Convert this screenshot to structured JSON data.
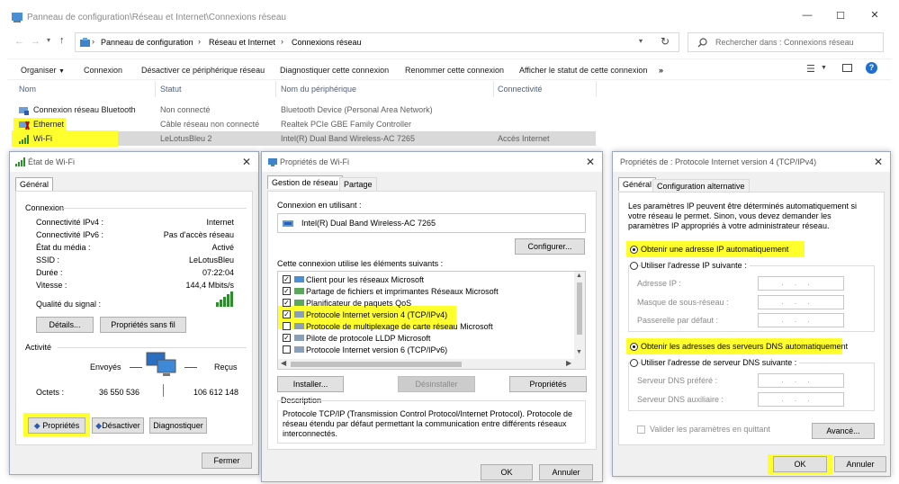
{
  "explorer": {
    "title": "Panneau de configuration\\Réseau et Internet\\Connexions réseau",
    "breadcrumb": [
      "Panneau de configuration",
      "Réseau et Internet",
      "Connexions réseau"
    ],
    "search_placeholder": "Rechercher dans : Connexions réseau",
    "commands": [
      "Organiser",
      "Connexion",
      "Désactiver ce périphérique réseau",
      "Diagnostiquer cette connexion",
      "Renommer cette connexion",
      "Afficher le statut de cette connexion",
      "»"
    ],
    "columns": [
      "Nom",
      "Statut",
      "Nom du périphérique",
      "Connectivité"
    ],
    "rows": [
      {
        "name": "Connexion réseau Bluetooth",
        "status": "Non connecté",
        "device": "Bluetooth Device (Personal Area Network)",
        "connectivity": ""
      },
      {
        "name": "Ethernet",
        "status": "Câble réseau non connecté",
        "device": "Realtek PCIe GBE Family Controller",
        "connectivity": ""
      },
      {
        "name": "Wi-Fi",
        "status": "LeLotusBleu  2",
        "device": "Intel(R) Dual Band Wireless-AC 7265",
        "connectivity": "Accès Internet"
      }
    ]
  },
  "status_dialog": {
    "title": "État de Wi-Fi",
    "tab": "Général",
    "connection_group": "Connexion",
    "fields": [
      {
        "label": "Connectivité IPv4 :",
        "value": "Internet"
      },
      {
        "label": "Connectivité IPv6 :",
        "value": "Pas d'accès réseau"
      },
      {
        "label": "État du média :",
        "value": "Activé"
      },
      {
        "label": "SSID :",
        "value": "LeLotusBleu"
      },
      {
        "label": "Durée :",
        "value": "07:22:04"
      },
      {
        "label": "Vitesse :",
        "value": "144,4 Mbits/s"
      }
    ],
    "signal_label": "Qualité du signal :",
    "details_button": "Détails...",
    "wireless_props_button": "Propriétés sans fil",
    "activity_group": "Activité",
    "sent_label": "Envoyés",
    "received_label": "Reçus",
    "octets_label": "Octets :",
    "octets_sent": "36 550 536",
    "octets_received": "106 612 148",
    "properties_button": "Propriétés",
    "disable_button": "Désactiver",
    "diagnose_button": "Diagnostiquer",
    "close_button": "Fermer"
  },
  "props_dialog": {
    "title": "Propriétés de Wi-Fi",
    "tabs": [
      "Gestion de réseau",
      "Partage"
    ],
    "connect_using_label": "Connexion en utilisant :",
    "adapter": "Intel(R) Dual Band Wireless-AC 7265",
    "configure_button": "Configurer...",
    "items_label": "Cette connexion utilise les éléments suivants :",
    "items": [
      {
        "label": "Client pour les réseaux Microsoft",
        "checked": true
      },
      {
        "label": "Partage de fichiers et imprimantes Réseaux Microsoft",
        "checked": true
      },
      {
        "label": "Planificateur de paquets QoS",
        "checked": true
      },
      {
        "label": "Protocole Internet version 4 (TCP/IPv4)",
        "checked": true
      },
      {
        "label": "Protocole de multiplexage de carte réseau Microsoft",
        "checked": false
      },
      {
        "label": "Pilote de protocole LLDP Microsoft",
        "checked": true
      },
      {
        "label": "Protocole Internet version 6 (TCP/IPv6)",
        "checked": false
      }
    ],
    "install_button": "Installer...",
    "uninstall_button": "Désinstaller",
    "properties_button": "Propriétés",
    "description_label": "Description",
    "description_text": "Protocole TCP/IP (Transmission Control Protocol/Internet Protocol). Protocole de réseau étendu par défaut permettant la communication entre différents réseaux interconnectés.",
    "ok_button": "OK",
    "cancel_button": "Annuler"
  },
  "ipv4_dialog": {
    "title": "Propriétés de : Protocole Internet version 4 (TCP/IPv4)",
    "tabs": [
      "Général",
      "Configuration alternative"
    ],
    "intro": "Les paramètres IP peuvent être déterminés automatiquement si votre réseau le permet. Sinon, vous devez demander les paramètres IP appropriés à votre administrateur réseau.",
    "auto_ip": "Obtenir une adresse IP automatiquement",
    "manual_ip": "Utiliser l'adresse IP suivante :",
    "ip_address": "Adresse IP :",
    "subnet_mask": "Masque de sous-réseau :",
    "gateway": "Passerelle par défaut :",
    "auto_dns": "Obtenir les adresses des serveurs DNS automatiquement",
    "manual_dns": "Utiliser l'adresse de serveur DNS suivante :",
    "preferred_dns": "Serveur DNS préféré :",
    "alternate_dns": "Serveur DNS auxiliaire :",
    "validate_on_exit": "Valider les paramètres en quittant",
    "advanced_button": "Avancé...",
    "ok_button": "OK",
    "cancel_button": "Annuler"
  },
  "highlight_color": "#ffff2e"
}
